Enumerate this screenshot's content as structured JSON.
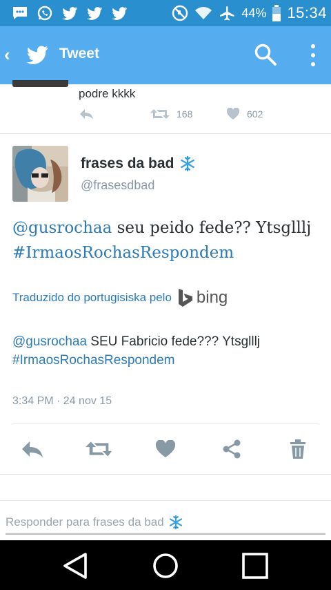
{
  "status_bar": {
    "battery_percent": "44%",
    "time": "15:34",
    "icons": [
      "messages-icon",
      "whatsapp-icon",
      "twitter-icon",
      "twitter-icon",
      "twitter-icon",
      "do-not-disturb-icon",
      "wifi-icon",
      "airplane-icon",
      "battery-icon"
    ]
  },
  "app_bar": {
    "title": "Tweet",
    "back_icon": "chevron-left-icon",
    "logo_icon": "twitter-bird-icon",
    "search_icon": "search-icon",
    "menu_icon": "overflow-menu-icon"
  },
  "previous_tweet": {
    "text": "podre kkkk",
    "retweet_count": "168",
    "like_count": "602"
  },
  "tweet": {
    "author_name": "frases da bad",
    "author_emoji": "❄️",
    "author_handle": "@frasesdbad",
    "mention": "@gusrochaa",
    "body_middle": " seu peido fede?? Ytsglllj ",
    "hashtag": "#IrmaosRochasRespondem",
    "translated_by_label": "Traduzido do portugisiska pelo",
    "translator_name": "bing",
    "translation_mention": "@gusrochaa",
    "translation_body": " SEU Fabricio fede??? Ytsglllj ",
    "translation_hashtag": "#IrmaosRochasRespondem",
    "timestamp": "3:34 PM · 24 nov 15"
  },
  "reply_box": {
    "placeholder": "Responder para frases da bad",
    "emoji": "❄️"
  },
  "colors": {
    "status_bar": "#2a8fcf",
    "app_bar": "#55acee",
    "link": "#2b7bb9",
    "muted": "#8899a6",
    "icon_gray": "#8899a6"
  }
}
